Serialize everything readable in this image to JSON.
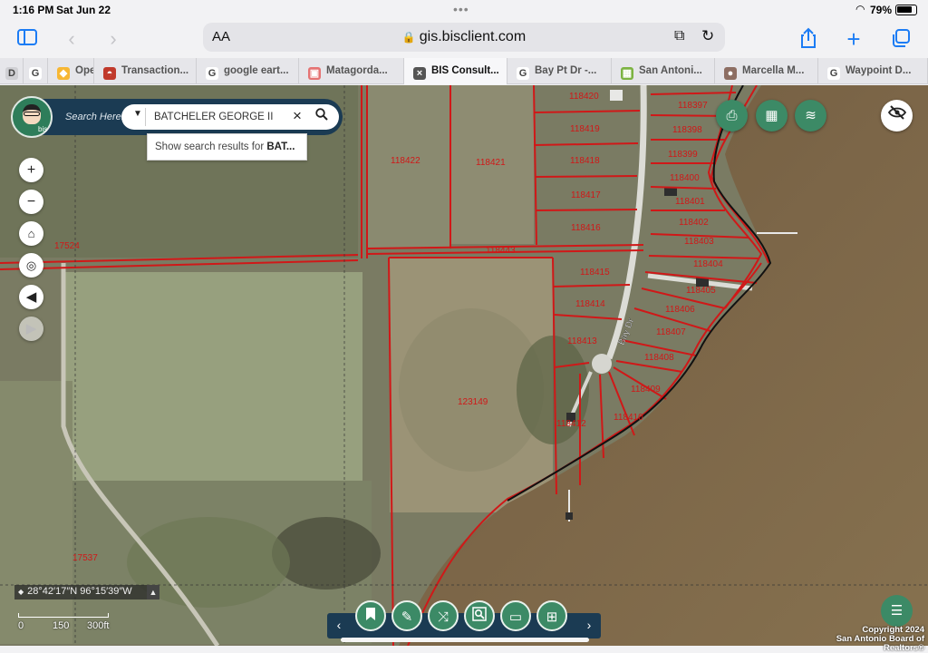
{
  "status": {
    "time": "1:16 PM",
    "date": "Sat Jun 22",
    "battery": "79%"
  },
  "browser": {
    "url": "gis.bisclient.com",
    "aa": "AA",
    "tabs": [
      {
        "label": "D",
        "fav": "D",
        "favColor": "#d0d0d4",
        "active": false
      },
      {
        "label": "",
        "fav": "G",
        "favColor": "#ffffff",
        "active": false
      },
      {
        "label": "Oper",
        "fav": "◆",
        "favColor": "#f7b733",
        "active": false
      },
      {
        "label": "Transaction...",
        "fav": "◓",
        "favColor": "#c0392b",
        "active": false
      },
      {
        "label": "google eart...",
        "fav": "G",
        "favColor": "#ffffff",
        "active": false
      },
      {
        "label": "Matagorda...",
        "fav": "▣",
        "favColor": "#e57373",
        "active": false
      },
      {
        "label": "BIS Consult...",
        "fav": "×",
        "favColor": "#555555",
        "active": true
      },
      {
        "label": "Bay Pt Dr -...",
        "fav": "G",
        "favColor": "#ffffff",
        "active": false
      },
      {
        "label": "San Antoni...",
        "fav": "▦",
        "favColor": "#7cb342",
        "active": false
      },
      {
        "label": "Marcella M...",
        "fav": "●",
        "favColor": "#8d6e63",
        "active": false
      },
      {
        "label": "Waypoint D...",
        "fav": "G",
        "favColor": "#ffffff",
        "active": false
      }
    ]
  },
  "search": {
    "label": "Search Here:",
    "value": "BATCHELER GEORGE II",
    "suggestion_prefix": "Show search results for ",
    "suggestion_bold": "BAT..."
  },
  "map": {
    "parcels": [
      {
        "id": "118420",
        "color": "#d01818"
      },
      {
        "id": "118419",
        "color": "#d01818"
      },
      {
        "id": "118418",
        "color": "#d01818"
      },
      {
        "id": "118417",
        "color": "#d01818"
      },
      {
        "id": "118416",
        "color": "#d01818"
      },
      {
        "id": "118422",
        "color": "#d01818"
      },
      {
        "id": "118421",
        "color": "#d01818"
      },
      {
        "id": "118443",
        "color": "#d01818"
      },
      {
        "id": "17524",
        "color": "#d01818"
      },
      {
        "id": "118415",
        "color": "#d01818"
      },
      {
        "id": "118414",
        "color": "#d01818"
      },
      {
        "id": "118413",
        "color": "#d01818"
      },
      {
        "id": "118412",
        "color": "#d01818"
      },
      {
        "id": "123149",
        "color": "#d01818"
      },
      {
        "id": "17537",
        "color": "#d01818"
      },
      {
        "id": "118397",
        "color": "#d01818"
      },
      {
        "id": "118398",
        "color": "#d01818"
      },
      {
        "id": "118399",
        "color": "#d01818"
      },
      {
        "id": "118400",
        "color": "#d01818"
      },
      {
        "id": "118401",
        "color": "#d01818"
      },
      {
        "id": "118402",
        "color": "#d01818"
      },
      {
        "id": "118403",
        "color": "#d01818"
      },
      {
        "id": "118404",
        "color": "#d01818"
      },
      {
        "id": "118405",
        "color": "#d01818"
      },
      {
        "id": "118406",
        "color": "#d01818"
      },
      {
        "id": "118407",
        "color": "#d01818"
      },
      {
        "id": "118408",
        "color": "#d01818"
      },
      {
        "id": "118409",
        "color": "#d01818"
      },
      {
        "id": "118410",
        "color": "#d01818"
      }
    ],
    "road_label": "Bay Dr",
    "coordinates": "28°42′17″N 96°15′39″W",
    "scale": [
      "0",
      "150",
      "300ft"
    ],
    "copyright_line1": "Copyright 2024",
    "copyright_line2": "San Antonio Board of Realtors®"
  }
}
